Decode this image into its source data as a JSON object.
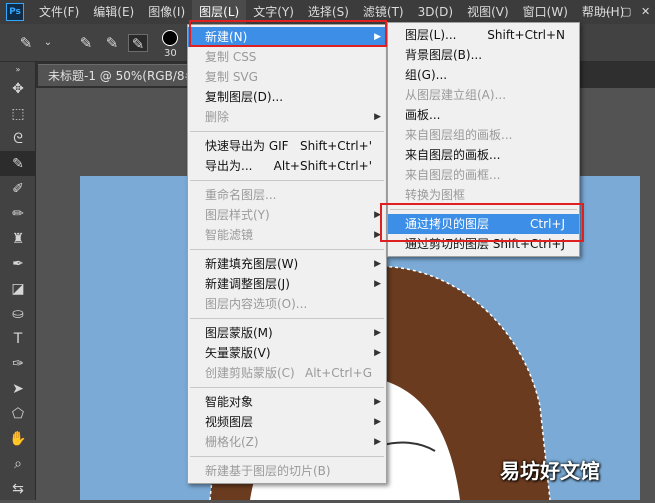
{
  "app": {
    "logo": "Ps"
  },
  "menubar": [
    {
      "label": "文件(F)"
    },
    {
      "label": "编辑(E)"
    },
    {
      "label": "图像(I)"
    },
    {
      "label": "图层(L)",
      "active": true
    },
    {
      "label": "文字(Y)"
    },
    {
      "label": "选择(S)"
    },
    {
      "label": "滤镜(T)"
    },
    {
      "label": "3D(D)"
    },
    {
      "label": "视图(V)"
    },
    {
      "label": "窗口(W)"
    },
    {
      "label": "帮助(H)"
    }
  ],
  "window_controls": [
    "—",
    "▢",
    "✕"
  ],
  "options": {
    "brush_size": "30"
  },
  "document": {
    "tab_title": "未标题-1 @ 50%(RGB/8#)",
    "close": "×"
  },
  "layer_menu": {
    "items": [
      {
        "label": "新建(N)",
        "highlight": true,
        "submenu": true
      },
      {
        "label": "复制 CSS",
        "disabled": true
      },
      {
        "label": "复制 SVG",
        "disabled": true
      },
      {
        "label": "复制图层(D)..."
      },
      {
        "label": "删除",
        "disabled": true,
        "submenu": true
      },
      {
        "sep": true
      },
      {
        "label": "快速导出为 GIF",
        "shortcut": "Shift+Ctrl+'"
      },
      {
        "label": "导出为...",
        "shortcut": "Alt+Shift+Ctrl+'"
      },
      {
        "sep": true
      },
      {
        "label": "重命名图层...",
        "disabled": true
      },
      {
        "label": "图层样式(Y)",
        "disabled": true,
        "submenu": true
      },
      {
        "label": "智能滤镜",
        "disabled": true,
        "submenu": true
      },
      {
        "sep": true
      },
      {
        "label": "新建填充图层(W)",
        "submenu": true
      },
      {
        "label": "新建调整图层(J)",
        "submenu": true
      },
      {
        "label": "图层内容选项(O)...",
        "disabled": true
      },
      {
        "sep": true
      },
      {
        "label": "图层蒙版(M)",
        "submenu": true
      },
      {
        "label": "矢量蒙版(V)",
        "submenu": true
      },
      {
        "label": "创建剪贴蒙版(C)",
        "shortcut": "Alt+Ctrl+G",
        "disabled": true
      },
      {
        "sep": true
      },
      {
        "label": "智能对象",
        "submenu": true
      },
      {
        "label": "视频图层",
        "submenu": true
      },
      {
        "label": "栅格化(Z)",
        "disabled": true,
        "submenu": true
      },
      {
        "sep": true
      },
      {
        "label": "新建基于图层的切片(B)",
        "disabled": true
      }
    ]
  },
  "new_submenu": {
    "items": [
      {
        "label": "图层(L)...",
        "shortcut": "Shift+Ctrl+N"
      },
      {
        "label": "背景图层(B)..."
      },
      {
        "label": "组(G)..."
      },
      {
        "label": "从图层建立组(A)...",
        "disabled": true
      },
      {
        "label": "画板..."
      },
      {
        "label": "来自图层组的画板...",
        "disabled": true
      },
      {
        "label": "来自图层的画板..."
      },
      {
        "label": "来自图层的画框...",
        "disabled": true
      },
      {
        "label": "转换为图框",
        "disabled": true
      },
      {
        "sep": true
      },
      {
        "label": "通过拷贝的图层",
        "shortcut": "Ctrl+J",
        "highlight": true
      },
      {
        "label": "通过剪切的图层",
        "shortcut": "Shift+Ctrl+J"
      }
    ]
  },
  "watermark": "易坊好文馆",
  "colors": {
    "menu_highlight": "#3d8ee6",
    "annotation": "#e02020",
    "canvas": "#7aaad5"
  }
}
